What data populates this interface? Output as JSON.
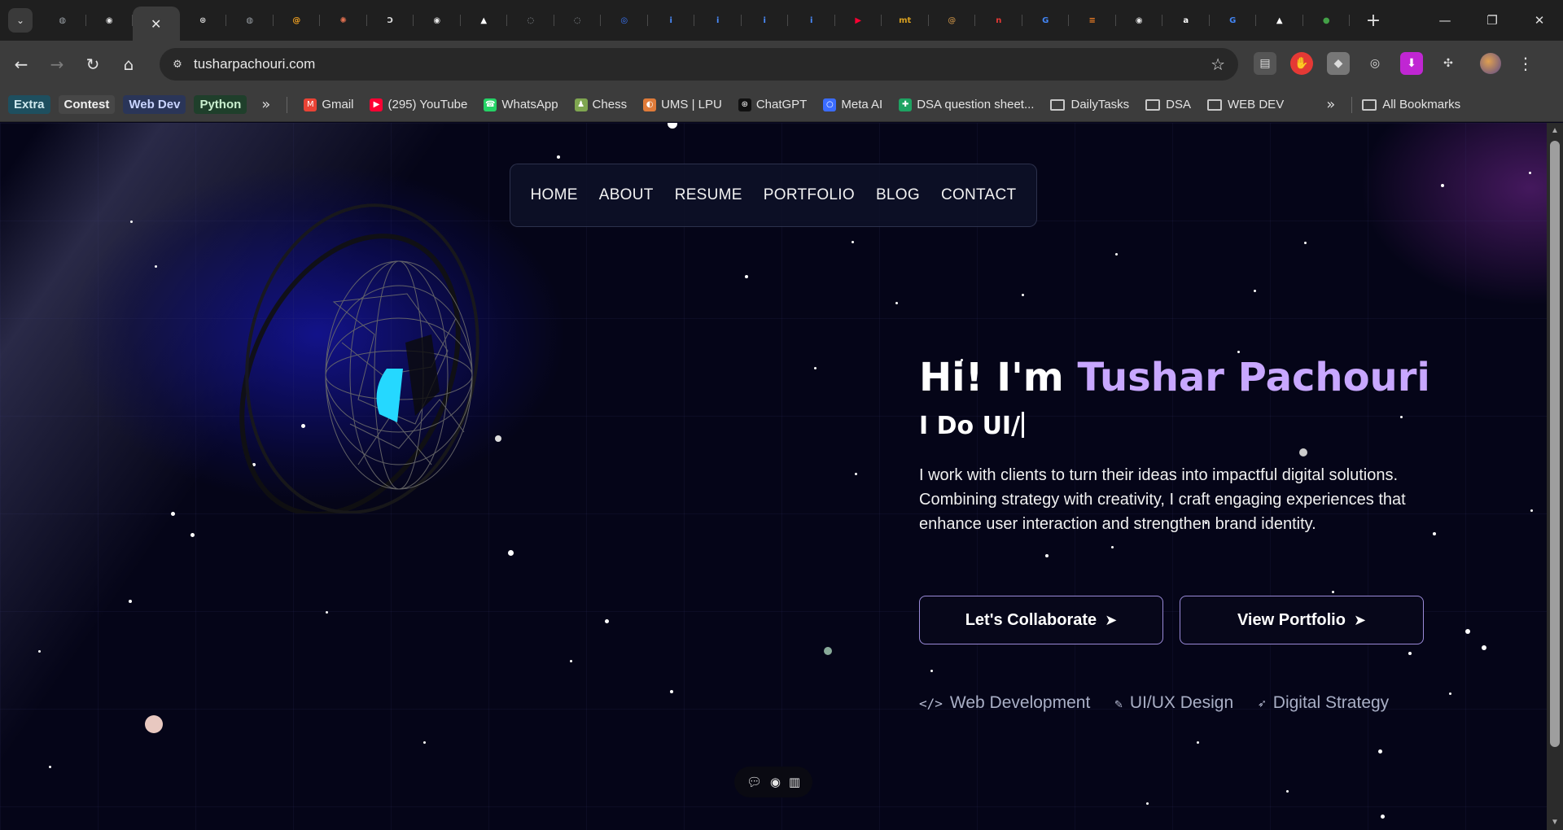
{
  "browser": {
    "tabs": [
      {
        "icon": "globe-icon",
        "color": "#9aa0a6",
        "glyph": "◍"
      },
      {
        "icon": "github-icon",
        "color": "#e6e6e6",
        "glyph": "◉"
      },
      {
        "icon": "close-icon",
        "active": true,
        "glyph": "✕"
      },
      {
        "icon": "openai-icon",
        "color": "#d0d0d0",
        "glyph": "⊛"
      },
      {
        "icon": "globe-icon",
        "color": "#9aa0a6",
        "glyph": "◍"
      },
      {
        "icon": "swirl-icon",
        "color": "#f0a020",
        "glyph": "@"
      },
      {
        "icon": "claude-icon",
        "color": "#e07050",
        "glyph": "✺"
      },
      {
        "icon": "d-logo-icon",
        "color": "#dddddd",
        "glyph": "Ↄ"
      },
      {
        "icon": "github-icon",
        "color": "#e6e6e6",
        "glyph": "◉"
      },
      {
        "icon": "triangle-icon",
        "color": "#ffffff",
        "glyph": "▲"
      },
      {
        "icon": "loading-icon",
        "color": "#9aa0a6",
        "glyph": "◌"
      },
      {
        "icon": "loading-icon",
        "color": "#9aa0a6",
        "glyph": "◌"
      },
      {
        "icon": "blue-circle-icon",
        "color": "#3a78ff",
        "glyph": "◎"
      },
      {
        "icon": "i-logo-icon",
        "color": "#4a8cff",
        "glyph": "i"
      },
      {
        "icon": "i-logo-icon",
        "color": "#4a8cff",
        "glyph": "i"
      },
      {
        "icon": "i-logo-icon",
        "color": "#4a8cff",
        "glyph": "i"
      },
      {
        "icon": "i-logo-icon",
        "color": "#4a8cff",
        "glyph": "i"
      },
      {
        "icon": "youtube-icon",
        "color": "#ff0033",
        "glyph": "▶"
      },
      {
        "icon": "mt-icon",
        "color": "#d8a020",
        "glyph": "mt"
      },
      {
        "icon": "swirl-icon",
        "color": "#b08040",
        "glyph": "@"
      },
      {
        "icon": "n-logo-icon",
        "color": "#e53935",
        "glyph": "n"
      },
      {
        "icon": "google-icon",
        "color": "#4285f4",
        "glyph": "G"
      },
      {
        "icon": "stack-icon",
        "color": "#f48024",
        "glyph": "≡"
      },
      {
        "icon": "github-icon",
        "color": "#e6e6e6",
        "glyph": "◉"
      },
      {
        "icon": "amazon-icon",
        "color": "#ffffff",
        "glyph": "a"
      },
      {
        "icon": "google-icon",
        "color": "#4285f4",
        "glyph": "G"
      },
      {
        "icon": "triangle-icon",
        "color": "#ffffff",
        "glyph": "▲"
      },
      {
        "icon": "green-icon",
        "color": "#43a047",
        "glyph": "●"
      }
    ],
    "url": "tusharpachouri.com",
    "bookmark_chips": [
      {
        "label": "Extra",
        "bg": "#1e4f5f",
        "fg": "#cfe9ef"
      },
      {
        "label": "Contest",
        "bg": "#474747",
        "fg": "#f0f0f0"
      },
      {
        "label": "Web Dev",
        "bg": "#2a3558",
        "fg": "#c9d4ff"
      },
      {
        "label": "Python",
        "bg": "#1f3f2b",
        "fg": "#c9efcf"
      }
    ],
    "bookmarks": [
      {
        "label": "Gmail",
        "icon": "gmail-icon",
        "color": "#ea4335",
        "glyph": "M"
      },
      {
        "label": "(295) YouTube",
        "icon": "youtube-icon",
        "color": "#ff0033",
        "glyph": "▶"
      },
      {
        "label": "WhatsApp",
        "icon": "whatsapp-icon",
        "color": "#25d366",
        "glyph": "☎"
      },
      {
        "label": "Chess",
        "icon": "chess-icon",
        "color": "#7fa650",
        "glyph": "♟"
      },
      {
        "label": "UMS | LPU",
        "icon": "lpu-icon",
        "color": "#e07b39",
        "glyph": "◐"
      },
      {
        "label": "ChatGPT",
        "icon": "openai-icon",
        "color": "#111111",
        "glyph": "⊛"
      },
      {
        "label": "Meta AI",
        "icon": "meta-icon",
        "color": "#3b6cff",
        "glyph": "○"
      },
      {
        "label": "DSA question sheet...",
        "icon": "sheets-icon",
        "color": "#1ea362",
        "glyph": "✚"
      }
    ],
    "bookmark_folders": [
      "DailyTasks",
      "DSA",
      "WEB DEV"
    ],
    "all_bookmarks": "All Bookmarks"
  },
  "page": {
    "nav": [
      "HOME",
      "ABOUT",
      "RESUME",
      "PORTFOLIO",
      "BLOG",
      "CONTACT"
    ],
    "greeting": "Hi! I'm ",
    "name": "Tushar Pachouri",
    "typing": "I Do UI/",
    "description": "I work with clients to turn their ideas into impactful digital solutions. Combining strategy with creativity, I craft engaging experiences that enhance user interaction and strengthen brand identity.",
    "cta_primary": "Let's Collaborate",
    "cta_secondary": "View Portfolio",
    "skills": [
      {
        "label": "Web Development",
        "icon": "code-icon",
        "glyph": "</>"
      },
      {
        "label": "UI/UX Design",
        "icon": "brush-icon",
        "glyph": "✎"
      },
      {
        "label": "Digital Strategy",
        "icon": "rocket-icon",
        "glyph": "➶"
      }
    ],
    "colors": {
      "accent": "#c8a7ff",
      "background": "#050518",
      "button_border": "#9a8ad8"
    }
  }
}
